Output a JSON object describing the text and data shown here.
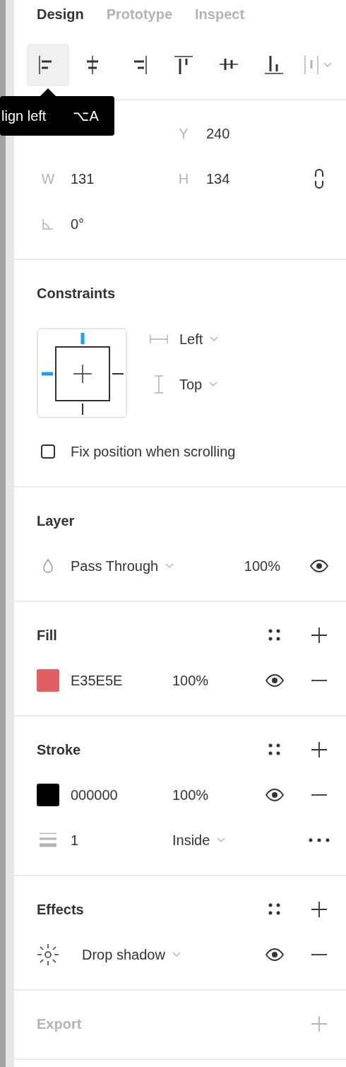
{
  "tabs": [
    {
      "label": "Design",
      "selected": true
    },
    {
      "label": "Prototype",
      "selected": false
    },
    {
      "label": "Inspect",
      "selected": false
    }
  ],
  "align_tools": [
    {
      "kind": "left",
      "selected": true,
      "disabled": false
    },
    {
      "kind": "hcenter",
      "selected": false,
      "disabled": false
    },
    {
      "kind": "right",
      "selected": false,
      "disabled": false
    },
    {
      "kind": "top",
      "selected": false,
      "disabled": false
    },
    {
      "kind": "vcenter",
      "selected": false,
      "disabled": false
    },
    {
      "kind": "bottom",
      "selected": false,
      "disabled": false
    },
    {
      "kind": "distribute",
      "selected": false,
      "disabled": true
    }
  ],
  "tooltip": {
    "label": "lign left",
    "shortcut": "⌥A"
  },
  "position": {
    "y": {
      "label": "Y",
      "value": "240"
    },
    "w": {
      "label": "W",
      "value": "131"
    },
    "h": {
      "label": "H",
      "value": "134"
    },
    "proportions_locked": false,
    "rotation": "0°"
  },
  "constraints": {
    "title": "Constraints",
    "pins": {
      "top": true,
      "left": true,
      "right": false,
      "bottom": false
    },
    "horizontal": "Left",
    "vertical": "Top",
    "fix_position": {
      "label": "Fix position when scrolling",
      "checked": false
    }
  },
  "layer": {
    "title": "Layer",
    "blend_mode": "Pass Through",
    "opacity": "100%",
    "visible": true
  },
  "fill": {
    "title": "Fill",
    "items": [
      {
        "color": "#e35e5e",
        "hex": "E35E5E",
        "opacity": "100%",
        "visible": true
      }
    ]
  },
  "stroke": {
    "title": "Stroke",
    "items": [
      {
        "color": "#000000",
        "hex": "000000",
        "opacity": "100%",
        "visible": true
      }
    ],
    "weight": "1",
    "align": "Inside"
  },
  "effects": {
    "title": "Effects",
    "items": [
      {
        "type": "Drop shadow",
        "visible": true
      }
    ]
  },
  "export": {
    "title": "Export",
    "disabled": true
  }
}
